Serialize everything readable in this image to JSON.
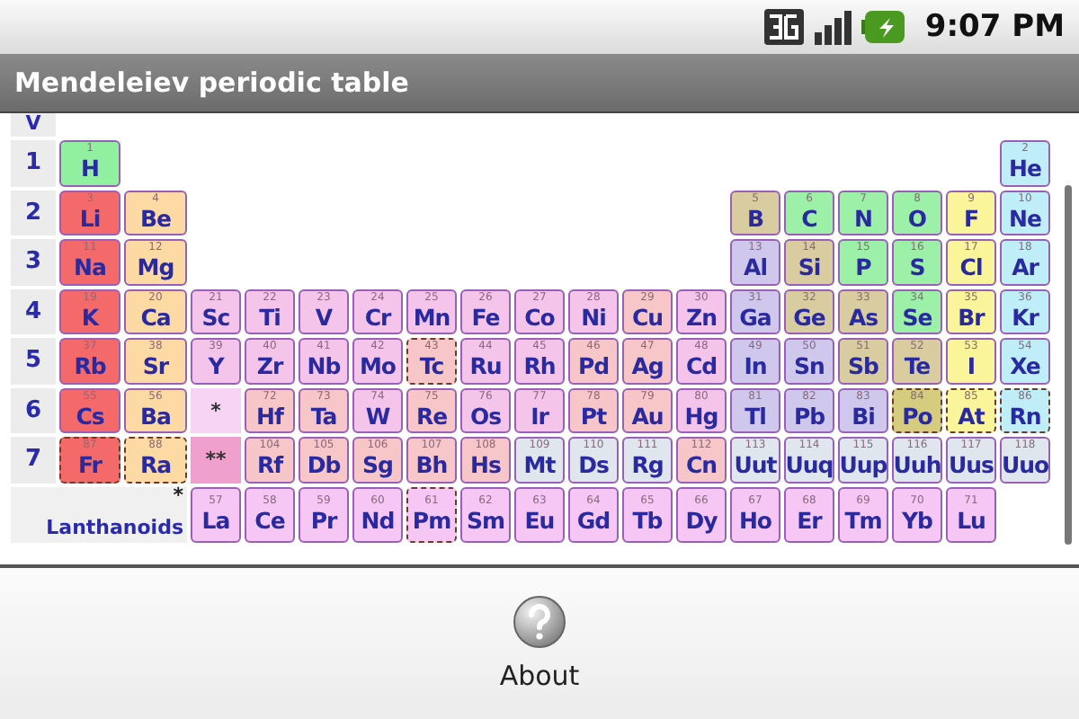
{
  "status_bar": {
    "time": "9:07 PM"
  },
  "window": {
    "title": "Mendeleiev periodic table"
  },
  "column_header": "V",
  "periods": [
    {
      "label": "1",
      "cells": [
        {
          "number": "1",
          "symbol": "H",
          "color": "#90f0a0",
          "dashed": false
        }
      ],
      "right_cells": [
        {
          "number": "2",
          "symbol": "He",
          "color": "#bfeef8",
          "dashed": false
        }
      ]
    },
    {
      "label": "2",
      "cells": [
        {
          "number": "3",
          "symbol": "Li",
          "color": "#f46a6a",
          "dashed": false
        },
        {
          "number": "4",
          "symbol": "Be",
          "color": "#fdd9a4",
          "dashed": false
        }
      ],
      "right_cells": [
        {
          "number": "5",
          "symbol": "B",
          "color": "#d8cca0",
          "dashed": false
        },
        {
          "number": "6",
          "symbol": "C",
          "color": "#9cf0a8",
          "dashed": false
        },
        {
          "number": "7",
          "symbol": "N",
          "color": "#9cf0a8",
          "dashed": false
        },
        {
          "number": "8",
          "symbol": "O",
          "color": "#9cf0a8",
          "dashed": false
        },
        {
          "number": "9",
          "symbol": "F",
          "color": "#faf49a",
          "dashed": false
        },
        {
          "number": "10",
          "symbol": "Ne",
          "color": "#bfeef8",
          "dashed": false
        }
      ]
    },
    {
      "label": "3",
      "cells": [
        {
          "number": "11",
          "symbol": "Na",
          "color": "#f46a6a",
          "dashed": false
        },
        {
          "number": "12",
          "symbol": "Mg",
          "color": "#fdd9a4",
          "dashed": false
        }
      ],
      "right_cells": [
        {
          "number": "13",
          "symbol": "Al",
          "color": "#cfc8ec",
          "dashed": false
        },
        {
          "number": "14",
          "symbol": "Si",
          "color": "#d8cca0",
          "dashed": false
        },
        {
          "number": "15",
          "symbol": "P",
          "color": "#9cf0a8",
          "dashed": false
        },
        {
          "number": "16",
          "symbol": "S",
          "color": "#9cf0a8",
          "dashed": false
        },
        {
          "number": "17",
          "symbol": "Cl",
          "color": "#faf49a",
          "dashed": false
        },
        {
          "number": "18",
          "symbol": "Ar",
          "color": "#bfeef8",
          "dashed": false
        }
      ]
    },
    {
      "label": "4",
      "cells": [
        {
          "number": "19",
          "symbol": "K",
          "color": "#f46a6a",
          "dashed": false
        },
        {
          "number": "20",
          "symbol": "Ca",
          "color": "#fdd9a4",
          "dashed": false
        },
        {
          "number": "21",
          "symbol": "Sc",
          "color": "#f4c4ea",
          "dashed": false
        },
        {
          "number": "22",
          "symbol": "Ti",
          "color": "#f4c4ea",
          "dashed": false
        },
        {
          "number": "23",
          "symbol": "V",
          "color": "#f4c4ea",
          "dashed": false
        },
        {
          "number": "24",
          "symbol": "Cr",
          "color": "#f4c4ea",
          "dashed": false
        },
        {
          "number": "25",
          "symbol": "Mn",
          "color": "#f4c4ea",
          "dashed": false
        },
        {
          "number": "26",
          "symbol": "Fe",
          "color": "#f4c4ea",
          "dashed": false
        },
        {
          "number": "27",
          "symbol": "Co",
          "color": "#f4c4ea",
          "dashed": false
        },
        {
          "number": "28",
          "symbol": "Ni",
          "color": "#f4c4ea",
          "dashed": false
        },
        {
          "number": "29",
          "symbol": "Cu",
          "color": "#f7c6c8",
          "dashed": false
        },
        {
          "number": "30",
          "symbol": "Zn",
          "color": "#f4c4ea",
          "dashed": false
        },
        {
          "number": "31",
          "symbol": "Ga",
          "color": "#cfc8ec",
          "dashed": false
        },
        {
          "number": "32",
          "symbol": "Ge",
          "color": "#d8cca0",
          "dashed": false
        },
        {
          "number": "33",
          "symbol": "As",
          "color": "#d8cca0",
          "dashed": false
        },
        {
          "number": "34",
          "symbol": "Se",
          "color": "#9cf0a8",
          "dashed": false
        },
        {
          "number": "35",
          "symbol": "Br",
          "color": "#faf49a",
          "dashed": false
        },
        {
          "number": "36",
          "symbol": "Kr",
          "color": "#bfeef8",
          "dashed": false
        }
      ]
    },
    {
      "label": "5",
      "cells": [
        {
          "number": "37",
          "symbol": "Rb",
          "color": "#f46a6a",
          "dashed": false
        },
        {
          "number": "38",
          "symbol": "Sr",
          "color": "#fdd9a4",
          "dashed": false
        },
        {
          "number": "39",
          "symbol": "Y",
          "color": "#f4c4ea",
          "dashed": false
        },
        {
          "number": "40",
          "symbol": "Zr",
          "color": "#f4c4ea",
          "dashed": false
        },
        {
          "number": "41",
          "symbol": "Nb",
          "color": "#f4c4ea",
          "dashed": false
        },
        {
          "number": "42",
          "symbol": "Mo",
          "color": "#f4c4ea",
          "dashed": false
        },
        {
          "number": "43",
          "symbol": "Tc",
          "color": "#f7c6c8",
          "dashed": true
        },
        {
          "number": "44",
          "symbol": "Ru",
          "color": "#f4c4ea",
          "dashed": false
        },
        {
          "number": "45",
          "symbol": "Rh",
          "color": "#f4c4ea",
          "dashed": false
        },
        {
          "number": "46",
          "symbol": "Pd",
          "color": "#f7c6c8",
          "dashed": false
        },
        {
          "number": "47",
          "symbol": "Ag",
          "color": "#f7c6c8",
          "dashed": false
        },
        {
          "number": "48",
          "symbol": "Cd",
          "color": "#f4c4ea",
          "dashed": false
        },
        {
          "number": "49",
          "symbol": "In",
          "color": "#cfc8ec",
          "dashed": false
        },
        {
          "number": "50",
          "symbol": "Sn",
          "color": "#cfc8ec",
          "dashed": false
        },
        {
          "number": "51",
          "symbol": "Sb",
          "color": "#d8cca0",
          "dashed": false
        },
        {
          "number": "52",
          "symbol": "Te",
          "color": "#d8cca0",
          "dashed": false
        },
        {
          "number": "53",
          "symbol": "I",
          "color": "#faf49a",
          "dashed": false
        },
        {
          "number": "54",
          "symbol": "Xe",
          "color": "#bfeef8",
          "dashed": false
        }
      ]
    },
    {
      "label": "6",
      "cells": [
        {
          "kind": "element",
          "number": "55",
          "symbol": "Cs",
          "color": "#f46a6a",
          "dashed": false
        },
        {
          "kind": "element",
          "number": "56",
          "symbol": "Ba",
          "color": "#fdd9a4",
          "dashed": false
        },
        {
          "kind": "marker",
          "symbol": "*",
          "color": "#f8d4f4"
        },
        {
          "kind": "element",
          "number": "72",
          "symbol": "Hf",
          "color": "#f7c6c8",
          "dashed": false
        },
        {
          "kind": "element",
          "number": "73",
          "symbol": "Ta",
          "color": "#f7c6c8",
          "dashed": false
        },
        {
          "kind": "element",
          "number": "74",
          "symbol": "W",
          "color": "#f4c4ea",
          "dashed": false
        },
        {
          "kind": "element",
          "number": "75",
          "symbol": "Re",
          "color": "#f7c6c8",
          "dashed": false
        },
        {
          "kind": "element",
          "number": "76",
          "symbol": "Os",
          "color": "#f4c4ea",
          "dashed": false
        },
        {
          "kind": "element",
          "number": "77",
          "symbol": "Ir",
          "color": "#f4c4ea",
          "dashed": false
        },
        {
          "kind": "element",
          "number": "78",
          "symbol": "Pt",
          "color": "#f7c6c8",
          "dashed": false
        },
        {
          "kind": "element",
          "number": "79",
          "symbol": "Au",
          "color": "#f7c6c8",
          "dashed": false
        },
        {
          "kind": "element",
          "number": "80",
          "symbol": "Hg",
          "color": "#f4c4ea",
          "dashed": false
        },
        {
          "kind": "element",
          "number": "81",
          "symbol": "Tl",
          "color": "#cfc8ec",
          "dashed": false
        },
        {
          "kind": "element",
          "number": "82",
          "symbol": "Pb",
          "color": "#cfc8ec",
          "dashed": false
        },
        {
          "kind": "element",
          "number": "83",
          "symbol": "Bi",
          "color": "#cfc8ec",
          "dashed": false
        },
        {
          "kind": "element",
          "number": "84",
          "symbol": "Po",
          "color": "#d6cc80",
          "dashed": true
        },
        {
          "kind": "element",
          "number": "85",
          "symbol": "At",
          "color": "#faf49a",
          "dashed": true
        },
        {
          "kind": "element",
          "number": "86",
          "symbol": "Rn",
          "color": "#bfeef8",
          "dashed": true
        }
      ]
    },
    {
      "label": "7",
      "cells": [
        {
          "kind": "element",
          "number": "87",
          "symbol": "Fr",
          "color": "#f46a6a",
          "dashed": true
        },
        {
          "kind": "element",
          "number": "88",
          "symbol": "Ra",
          "color": "#fdd9a4",
          "dashed": true
        },
        {
          "kind": "marker",
          "symbol": "**",
          "color": "#f0a0cc"
        },
        {
          "kind": "element",
          "number": "104",
          "symbol": "Rf",
          "color": "#f7c6c8",
          "dashed": false
        },
        {
          "kind": "element",
          "number": "105",
          "symbol": "Db",
          "color": "#f7c6c8",
          "dashed": false
        },
        {
          "kind": "element",
          "number": "106",
          "symbol": "Sg",
          "color": "#f7c6c8",
          "dashed": false
        },
        {
          "kind": "element",
          "number": "107",
          "symbol": "Bh",
          "color": "#f7c6c8",
          "dashed": false
        },
        {
          "kind": "element",
          "number": "108",
          "symbol": "Hs",
          "color": "#f7c6c8",
          "dashed": false
        },
        {
          "kind": "element",
          "number": "109",
          "symbol": "Mt",
          "color": "#dfe6ee",
          "dashed": false
        },
        {
          "kind": "element",
          "number": "110",
          "symbol": "Ds",
          "color": "#dfe6ee",
          "dashed": false
        },
        {
          "kind": "element",
          "number": "111",
          "symbol": "Rg",
          "color": "#dfe6ee",
          "dashed": false
        },
        {
          "kind": "element",
          "number": "112",
          "symbol": "Cn",
          "color": "#f7c6c8",
          "dashed": false
        },
        {
          "kind": "element",
          "number": "113",
          "symbol": "Uut",
          "color": "#dfe6ee",
          "dashed": false
        },
        {
          "kind": "element",
          "number": "114",
          "symbol": "Uuq",
          "color": "#dfe6ee",
          "dashed": false
        },
        {
          "kind": "element",
          "number": "115",
          "symbol": "Uup",
          "color": "#dfe6ee",
          "dashed": false
        },
        {
          "kind": "element",
          "number": "116",
          "symbol": "Uuh",
          "color": "#dfe6ee",
          "dashed": false
        },
        {
          "kind": "element",
          "number": "117",
          "symbol": "Uus",
          "color": "#dfe6ee",
          "dashed": false
        },
        {
          "kind": "element",
          "number": "118",
          "symbol": "Uuo",
          "color": "#dfe6ee",
          "dashed": false
        }
      ]
    }
  ],
  "lanthanoids": {
    "marker": "*",
    "label": "Lanthanoids",
    "cells": [
      {
        "number": "57",
        "symbol": "La",
        "color": "#f6c6f4",
        "dashed": false
      },
      {
        "number": "58",
        "symbol": "Ce",
        "color": "#f6c6f4",
        "dashed": false
      },
      {
        "number": "59",
        "symbol": "Pr",
        "color": "#f6c6f4",
        "dashed": false
      },
      {
        "number": "60",
        "symbol": "Nd",
        "color": "#f6c6f4",
        "dashed": false
      },
      {
        "number": "61",
        "symbol": "Pm",
        "color": "#f6c6f4",
        "dashed": true
      },
      {
        "number": "62",
        "symbol": "Sm",
        "color": "#f6c6f4",
        "dashed": false
      },
      {
        "number": "63",
        "symbol": "Eu",
        "color": "#f6c6f4",
        "dashed": false
      },
      {
        "number": "64",
        "symbol": "Gd",
        "color": "#f6c6f4",
        "dashed": false
      },
      {
        "number": "65",
        "symbol": "Tb",
        "color": "#f6c6f4",
        "dashed": false
      },
      {
        "number": "66",
        "symbol": "Dy",
        "color": "#f6c6f4",
        "dashed": false
      },
      {
        "number": "67",
        "symbol": "Ho",
        "color": "#f6c6f4",
        "dashed": false
      },
      {
        "number": "68",
        "symbol": "Er",
        "color": "#f6c6f4",
        "dashed": false
      },
      {
        "number": "69",
        "symbol": "Tm",
        "color": "#f6c6f4",
        "dashed": false
      },
      {
        "number": "70",
        "symbol": "Yb",
        "color": "#f6c6f4",
        "dashed": false
      },
      {
        "number": "71",
        "symbol": "Lu",
        "color": "#f6c6f4",
        "dashed": false
      }
    ]
  },
  "menu": [
    {
      "label": "About"
    }
  ]
}
